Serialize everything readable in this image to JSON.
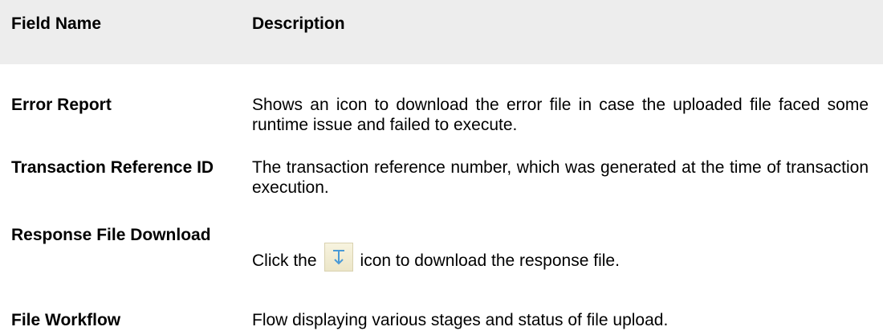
{
  "table": {
    "headers": {
      "field": "Field Name",
      "description": "Description"
    },
    "rows": [
      {
        "field": "Error Report",
        "description": "Shows an icon to download the error file in case the uploaded file faced some runtime issue and failed to execute."
      },
      {
        "field": "Transaction Reference ID",
        "description": "The transaction reference number, which was generated at the time of transaction execution."
      },
      {
        "field": "Response File Download",
        "description_before_icon": "Click the",
        "icon": "download-icon",
        "description_after_icon": "icon to download the response file."
      },
      {
        "field": "File Workflow",
        "description": "Flow displaying various stages and status of file upload."
      }
    ]
  },
  "colors": {
    "header_background": "#ededed",
    "icon_background": "#f3eed6",
    "icon_arrow": "#4a9ad6"
  }
}
